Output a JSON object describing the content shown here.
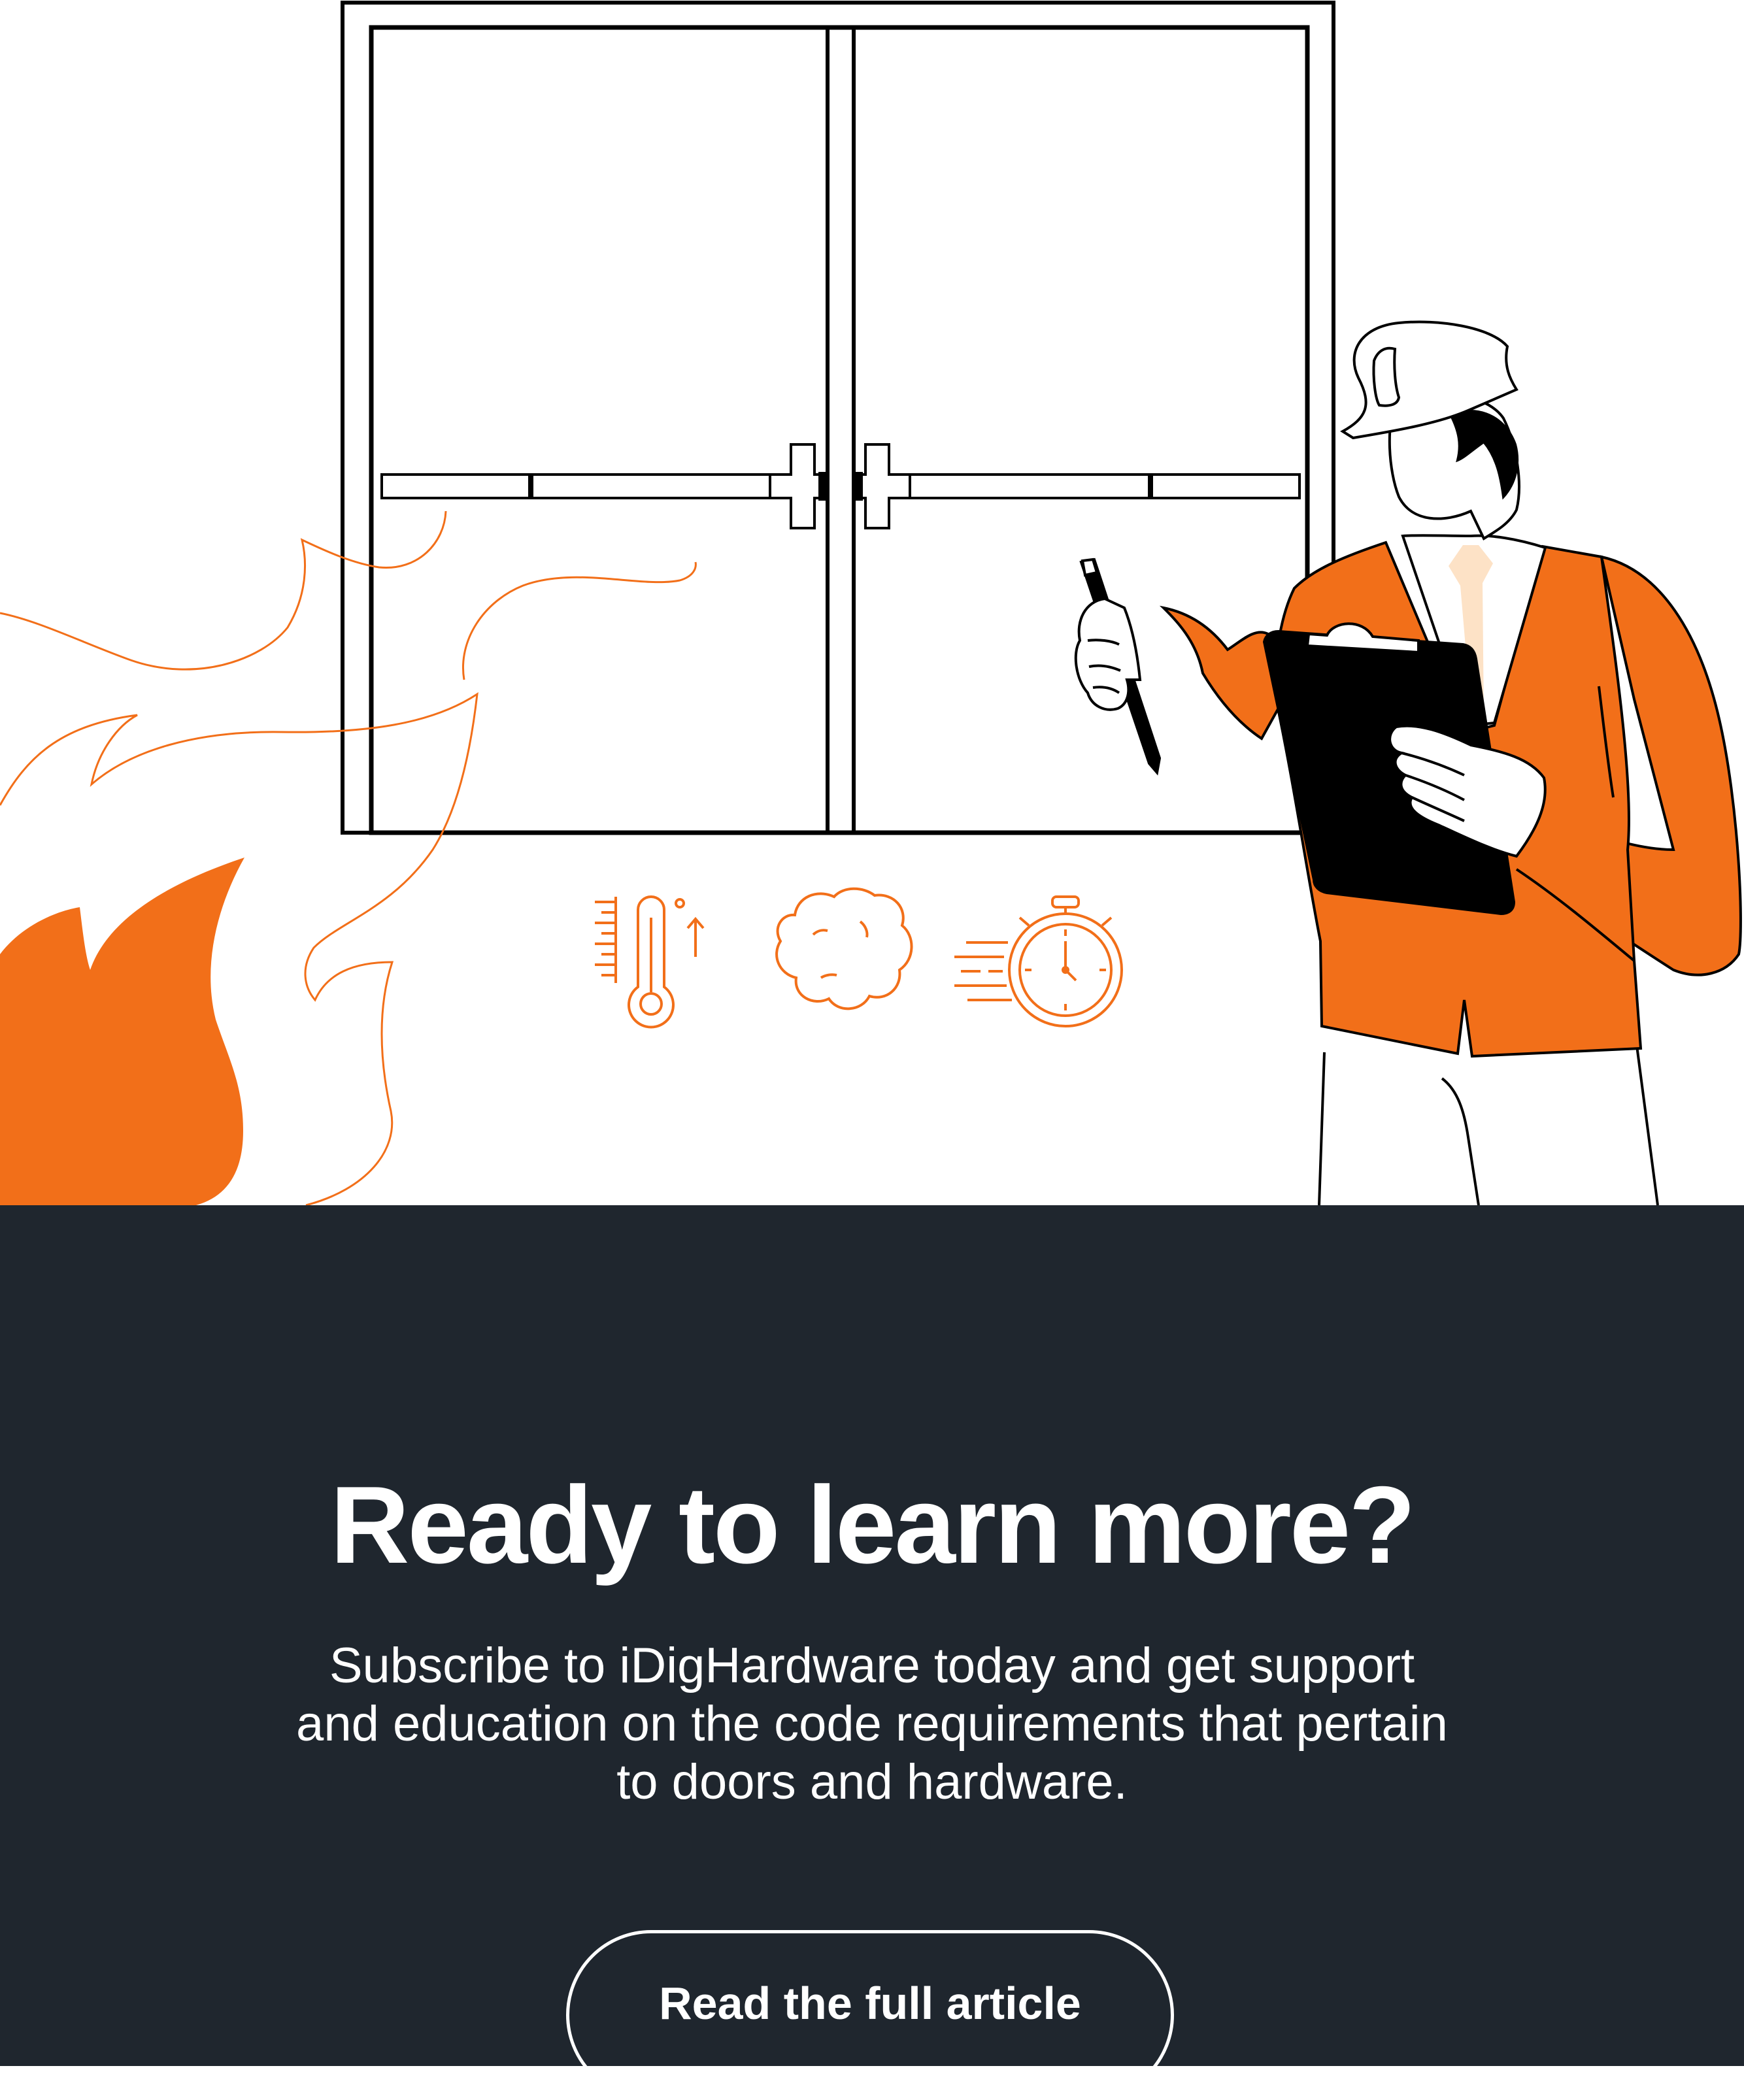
{
  "cta": {
    "title": "Ready to learn more?",
    "description": "Subscribe to iDigHardware today and get support and education on the code requirements that pertain to doors and hardware.",
    "button_label": "Read the full article"
  },
  "illustration": {
    "icons": [
      "door-icon",
      "flame-icon",
      "inspector-icon",
      "thermometer-icon",
      "smoke-icon",
      "stopwatch-icon",
      "clipboard-icon",
      "pen-icon"
    ]
  },
  "colors": {
    "accent": "#f26f19",
    "panel_background": "#1f262e",
    "text": "#ffffff",
    "ink": "#000000",
    "skin_tone": "#fde2c6"
  }
}
